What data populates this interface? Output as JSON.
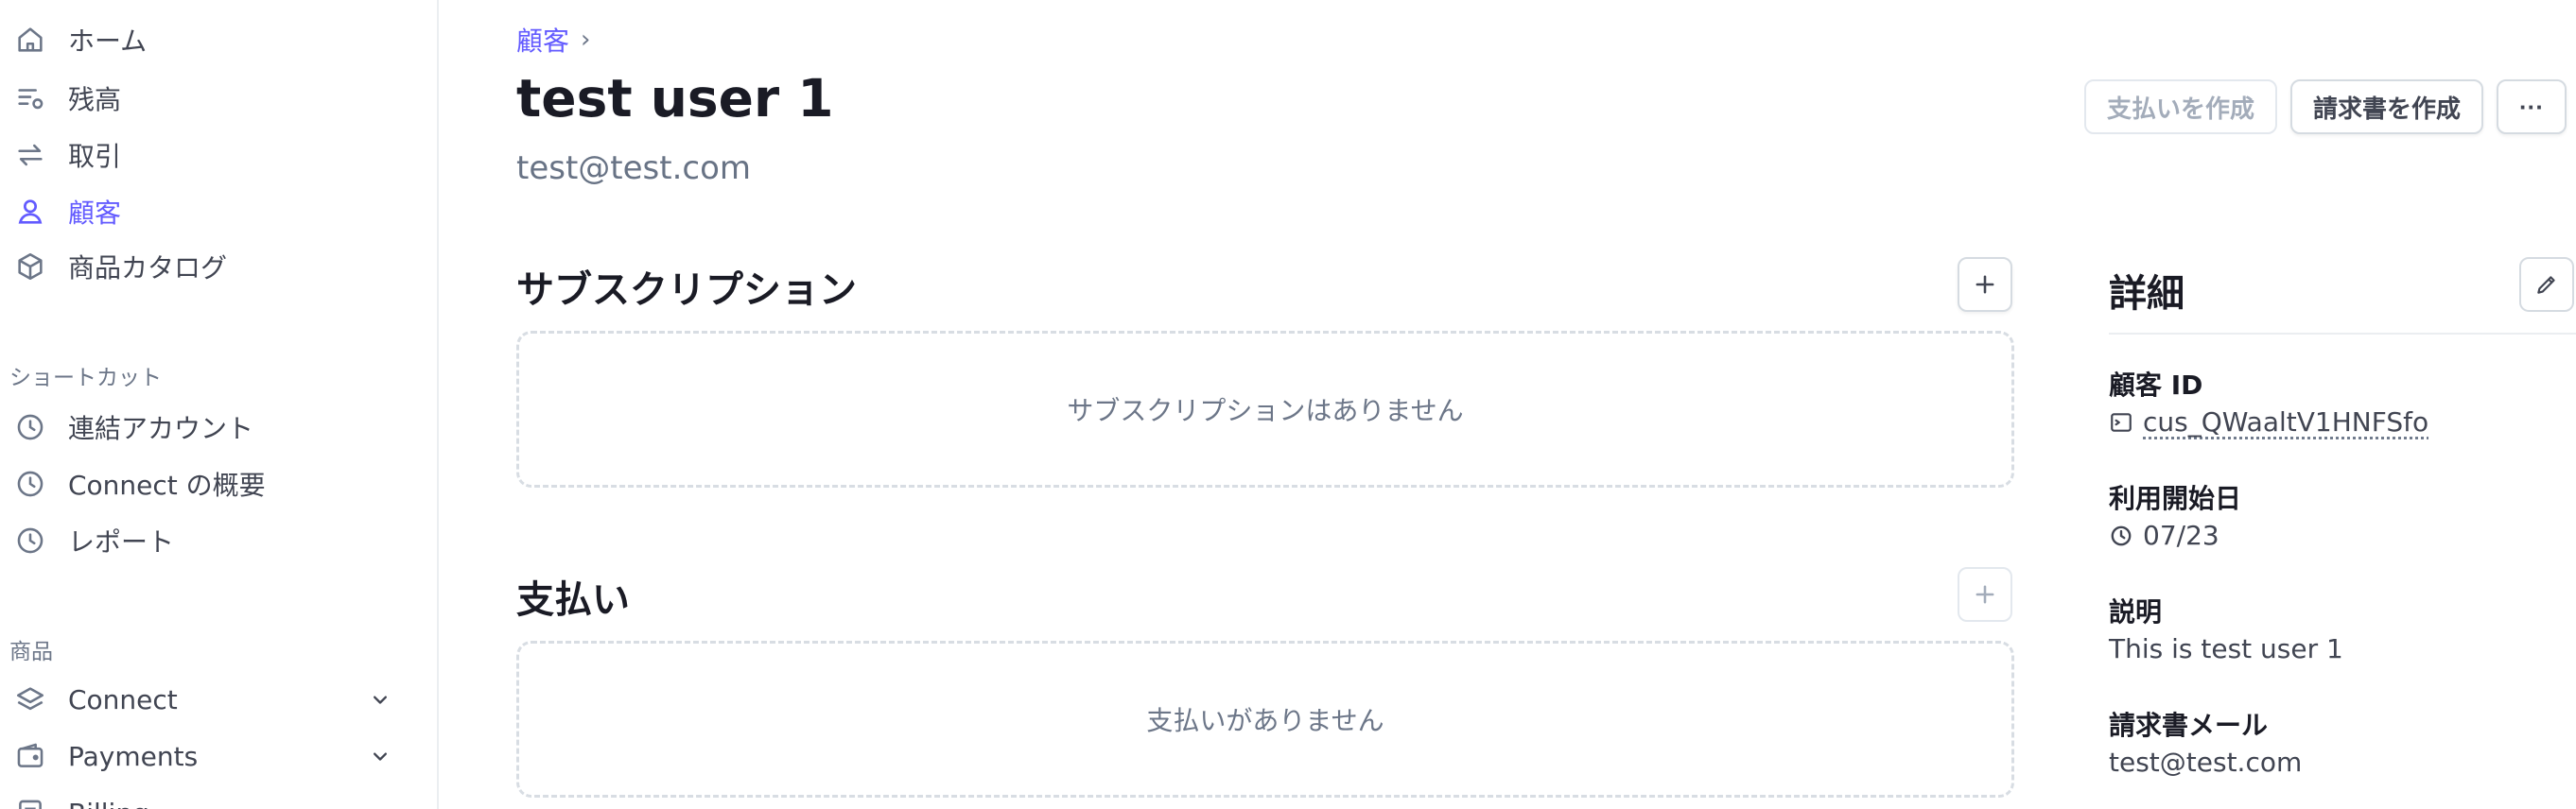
{
  "sidebar": {
    "items": [
      {
        "label": "ホーム",
        "icon": "home-icon"
      },
      {
        "label": "残高",
        "icon": "balance-icon"
      },
      {
        "label": "取引",
        "icon": "transactions-icon"
      },
      {
        "label": "顧客",
        "icon": "customer-icon",
        "active": true
      },
      {
        "label": "商品カタログ",
        "icon": "product-box-icon"
      }
    ],
    "shortcuts_title": "ショートカット",
    "shortcuts": [
      {
        "label": "連結アカウント",
        "icon": "clock-icon"
      },
      {
        "label": "Connect の概要",
        "icon": "clock-icon"
      },
      {
        "label": "レポート",
        "icon": "clock-icon"
      }
    ],
    "products_title": "商品",
    "products": [
      {
        "label": "Connect",
        "icon": "layers-icon"
      },
      {
        "label": "Payments",
        "icon": "wallet-icon"
      },
      {
        "label": "Billing",
        "icon": "billing-icon"
      }
    ]
  },
  "breadcrumb": {
    "parent": "顧客",
    "separator": "›"
  },
  "header": {
    "title": "test user 1",
    "subtitle": "test@test.com",
    "create_payment_label": "支払いを作成",
    "create_invoice_label": "請求書を作成",
    "more_label": "···"
  },
  "subscriptions": {
    "title": "サブスクリプション",
    "empty_message": "サブスクリプションはありません"
  },
  "payments": {
    "title": "支払い",
    "empty_message": "支払いがありません"
  },
  "details": {
    "title": "詳細",
    "customer_id_label": "顧客 ID",
    "customer_id_value": "cus_QWaaltV1HNFSfo",
    "start_date_label": "利用開始日",
    "start_date_value": "07/23",
    "description_label": "説明",
    "description_value": "This is test user 1",
    "billing_email_label": "請求書メール",
    "billing_email_value": "test@test.com"
  },
  "colors": {
    "accent": "#635bff",
    "text_primary": "#1a1b25",
    "text_secondary": "#687385",
    "border": "#d5dbe1"
  }
}
